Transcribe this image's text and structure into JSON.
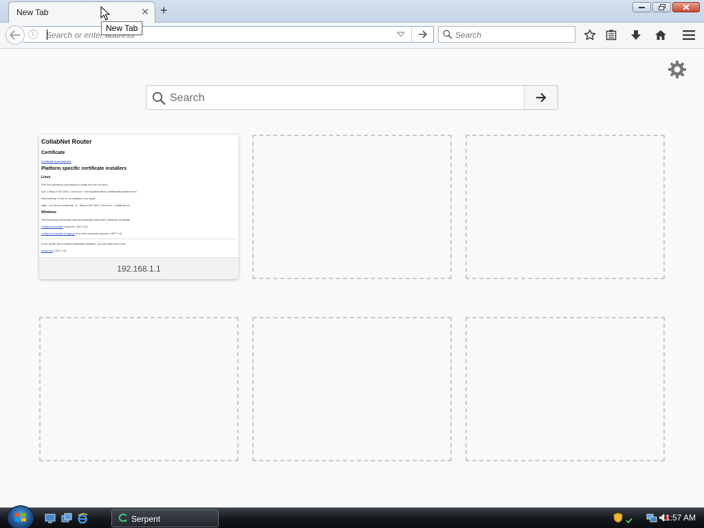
{
  "browser": {
    "tab": {
      "title": "New Tab"
    },
    "tooltip": "New Tab",
    "urlbar": {
      "placeholder": "Search or enter address",
      "value": ""
    },
    "searchbar": {
      "placeholder": "Search"
    }
  },
  "newtab": {
    "search": {
      "placeholder": "Search"
    },
    "tiles": [
      {
        "caption": "192.168.1.1",
        "thumbnail": {
          "heading": "CollabNet Router",
          "subheading": "Certificate",
          "cert_link": "Certificate download link",
          "section": "Platform specific certificate installers",
          "linux_heading": "Linux",
          "linux_intro": "Run the following commands to install the cert on linux:",
          "linux_cmd": "curl -k https://192.168.1.1/cert.crt > /usr/local/share/ca-certificates/collabnet.crt",
          "linux_alt": "Alternatively, if curl is not installed, use wget:",
          "linux_cmd2": "wget --no-check-certificate -O - https://192.168.1.1/cert.crt > collabnet.crt",
          "windows_heading": "Windows",
          "windows_intro": "The following executable will automatically install the Collabnet certificate.",
          "windows_link1": "Collabnet Installer",
          "windows_note1": "(requires .NET 4.5)",
          "windows_link2": "Collabnet Installer (Legacy)",
          "windows_note2": "(For older windows requires .NET 2.0)",
          "footer_intro": "If you prefer the previous certificate installers, you can find them here:",
          "footer_link": "setup.exe",
          "footer_note": "(.NET 4.5)"
        }
      }
    ]
  },
  "taskbar": {
    "task_label": "Serpent",
    "clock": "11:57 AM"
  },
  "colors": {
    "titlebar": "#c5d5e7",
    "toolbar": "#f5f6f7",
    "content_bg": "#f9f9fa",
    "urlbar_border": "#8fa9c8",
    "tile_border": "#c8c8c8"
  },
  "icons": [
    "close-icon",
    "plus-icon",
    "minimize-icon",
    "maximize-icon",
    "back-arrow-icon",
    "info-icon",
    "dropdown-icon",
    "arrow-right-icon",
    "search-icon",
    "star-icon",
    "reading-list-icon",
    "download-icon",
    "home-icon",
    "menu-icon",
    "gear-icon",
    "windows-orb-icon",
    "show-desktop-icon",
    "switch-windows-icon",
    "ie-icon",
    "serpent-icon",
    "shield-icon",
    "network-icon",
    "volume-muted-icon"
  ]
}
